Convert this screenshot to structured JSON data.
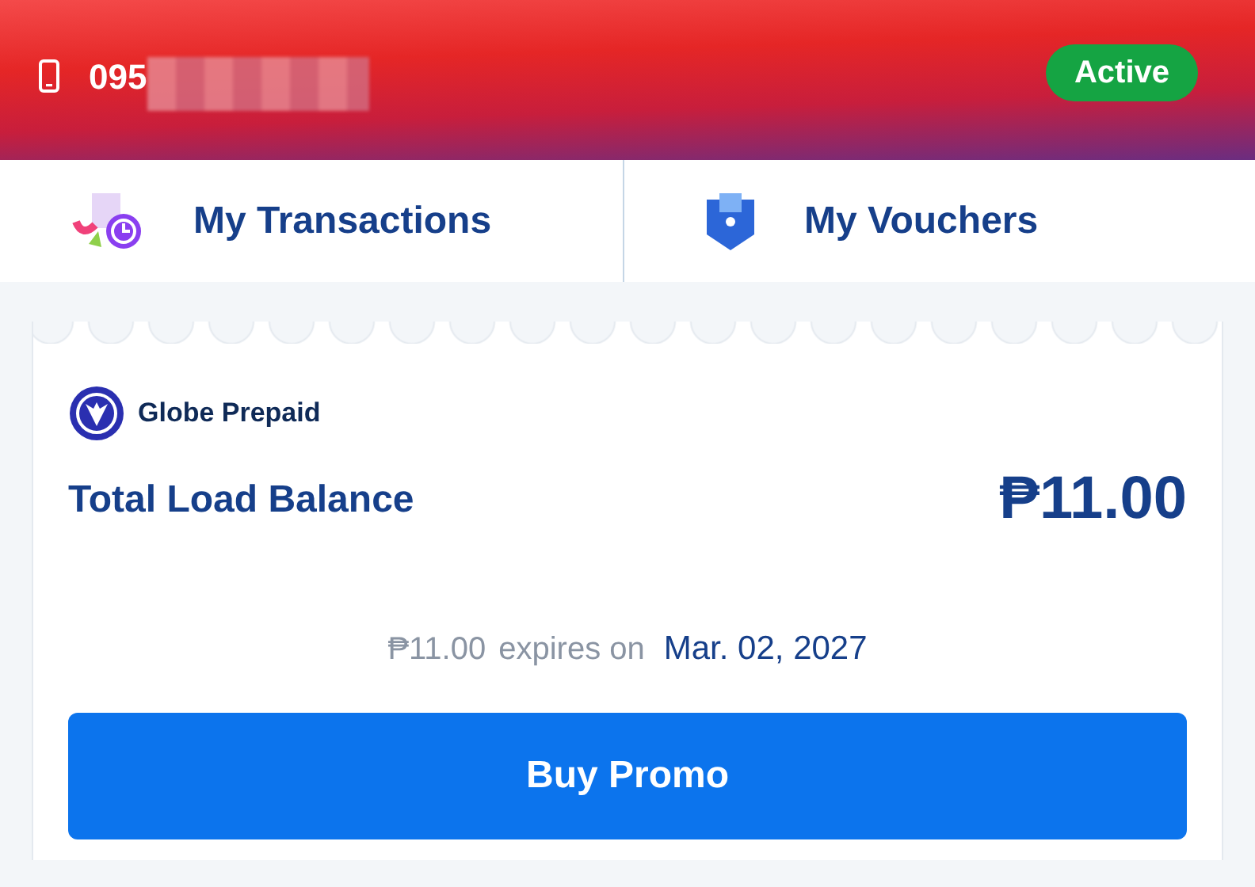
{
  "header": {
    "phone_number": "095",
    "status": "Active"
  },
  "nav": [
    {
      "label": "My Transactions",
      "kind": "transactions"
    },
    {
      "label": "My Vouchers",
      "kind": "vouchers"
    }
  ],
  "balance_card": {
    "brand": "Globe Prepaid",
    "label": "Total Load Balance",
    "amount": "₱11.00",
    "expiry_amount": "₱11.00",
    "expiry_text": "expires on",
    "expiry_date": "Mar. 02, 2027",
    "button": "Buy Promo"
  }
}
